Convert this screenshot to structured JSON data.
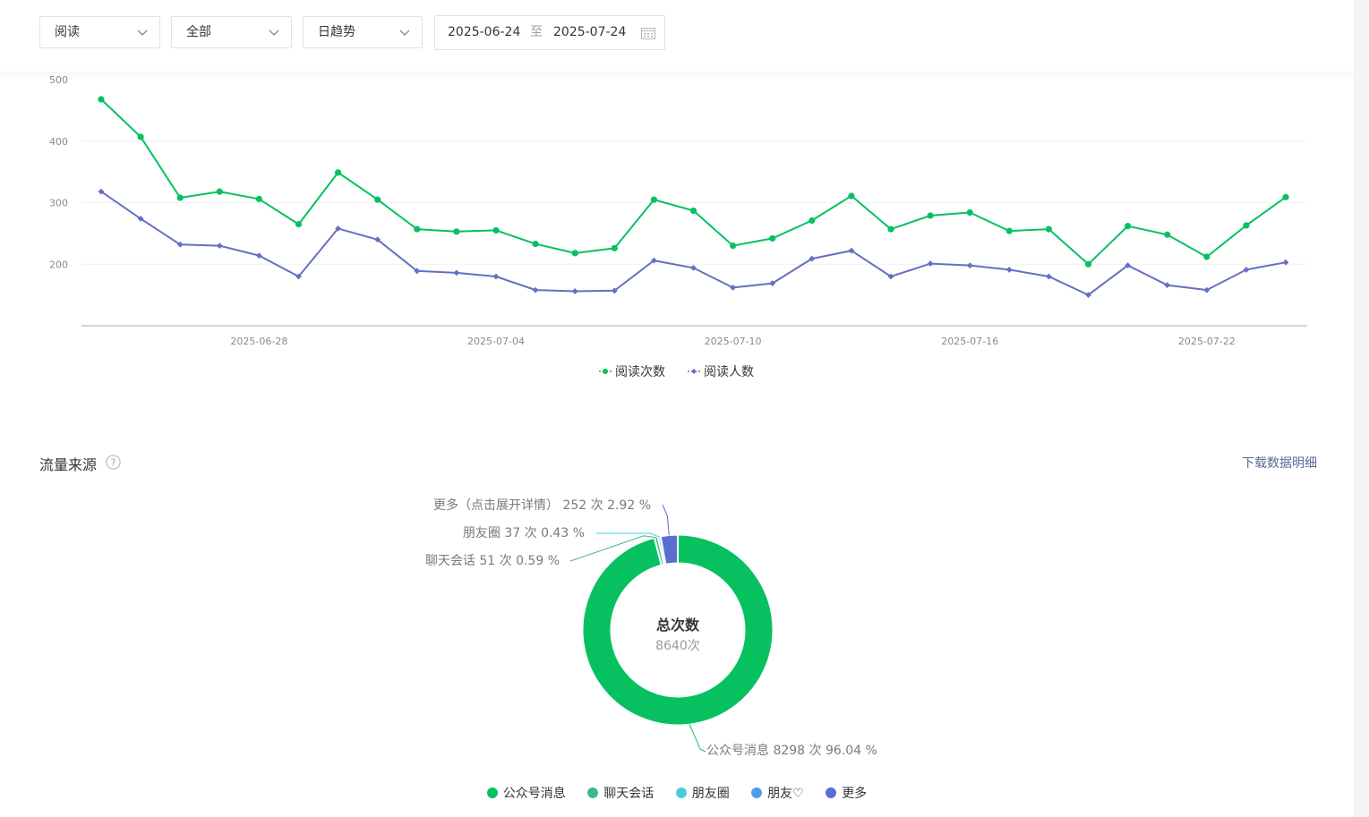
{
  "filters": {
    "metric": "阅读",
    "scope": "全部",
    "granularity": "日趋势",
    "date_start": "2025-06-24",
    "date_sep": "至",
    "date_end": "2025-07-24"
  },
  "trend": {
    "yticks": [
      "500",
      "400",
      "300",
      "200"
    ],
    "xticks": [
      "2025-06-28",
      "2025-07-04",
      "2025-07-10",
      "2025-07-16",
      "2025-07-22"
    ],
    "legend": [
      "阅读次数",
      "阅读人数"
    ]
  },
  "source": {
    "title": "流量来源",
    "download": "下载数据明细",
    "center_title": "总次数",
    "center_value": "8640次",
    "labels": {
      "more": "更多（点击展开详情） 252 次 2.92 %",
      "moments": "朋友圈 37 次 0.43 %",
      "chat": "聊天会话 51 次 0.59 %",
      "official": "公众号消息 8298 次 96.04 %"
    },
    "legend": [
      "公众号消息",
      "聊天会话",
      "朋友圈",
      "朋友♡",
      "更多"
    ]
  },
  "colors": {
    "green": "#07c160",
    "blue": "#6470c1",
    "teal": "#3eb88a",
    "cyan": "#4ccbe0",
    "lightblue": "#4b9fe8",
    "indigo": "#5b6dd0"
  },
  "chart_data": [
    {
      "type": "line",
      "x": [
        "2025-06-24",
        "2025-06-25",
        "2025-06-26",
        "2025-06-27",
        "2025-06-28",
        "2025-06-29",
        "2025-06-30",
        "2025-07-01",
        "2025-07-02",
        "2025-07-03",
        "2025-07-04",
        "2025-07-05",
        "2025-07-06",
        "2025-07-07",
        "2025-07-08",
        "2025-07-09",
        "2025-07-10",
        "2025-07-11",
        "2025-07-12",
        "2025-07-13",
        "2025-07-14",
        "2025-07-15",
        "2025-07-16",
        "2025-07-17",
        "2025-07-18",
        "2025-07-19",
        "2025-07-20",
        "2025-07-21",
        "2025-07-22",
        "2025-07-23",
        "2025-07-24"
      ],
      "series": [
        {
          "name": "阅读次数",
          "values": [
            468,
            407,
            308,
            318,
            306,
            265,
            349,
            305,
            257,
            253,
            255,
            233,
            218,
            226,
            305,
            287,
            230,
            242,
            271,
            311,
            257,
            279,
            284,
            254,
            257,
            200,
            262,
            248,
            212,
            263,
            309
          ]
        },
        {
          "name": "阅读人数",
          "values": [
            318,
            274,
            232,
            230,
            214,
            180,
            258,
            240,
            189,
            186,
            180,
            158,
            156,
            157,
            206,
            194,
            162,
            169,
            209,
            222,
            180,
            201,
            198,
            191,
            180,
            150,
            198,
            166,
            158,
            191,
            203
          ]
        }
      ],
      "ylim": [
        100,
        500
      ],
      "grid": true,
      "legend_position": "bottom"
    },
    {
      "type": "pie",
      "categories": [
        "公众号消息",
        "聊天会话",
        "朋友圈",
        "更多（点击展开详情）"
      ],
      "values": [
        8298,
        51,
        37,
        252
      ],
      "percent": [
        96.04,
        0.59,
        0.43,
        2.92
      ],
      "total": 8640,
      "legend_position": "bottom"
    }
  ]
}
